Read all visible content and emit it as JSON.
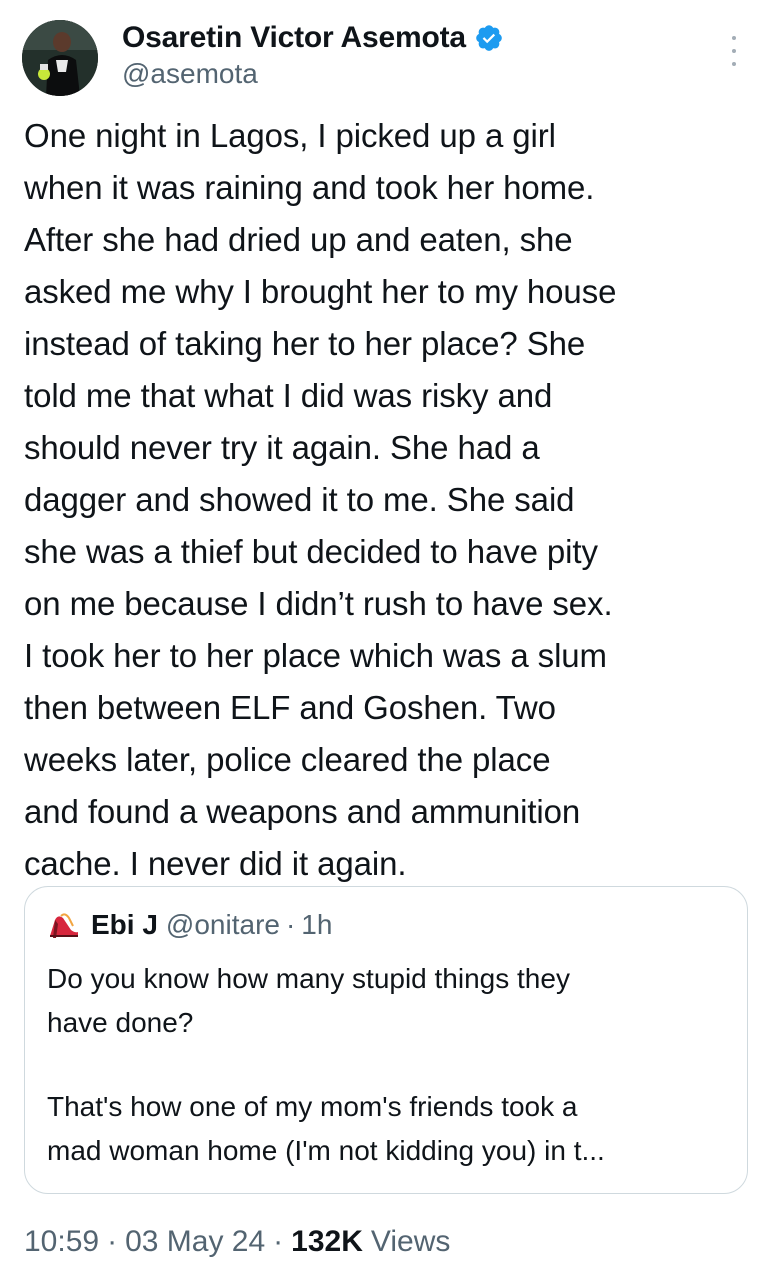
{
  "author": {
    "display_name": "Osaretin Victor Asemota",
    "handle": "@asemota",
    "verified": true,
    "verified_color": "#1d9bf0",
    "avatar_icon": "profile-photo-avatar"
  },
  "menu": {
    "icon": "more-vertical-icon"
  },
  "tweet": {
    "lines": [
      "One night in Lagos, I picked up a girl",
      "when it was raining and took her home.",
      "After she had dried up and eaten, she",
      "asked me why I brought her to my house",
      "instead of taking her to her place? She",
      "told me that what I did was risky and",
      "should never try it again. She had a",
      "dagger and showed it to me. She said",
      "she was a thief but decided to have pity",
      "on me because I didn’t rush to have sex.",
      "I took her to her place which was a slum",
      "then between ELF and Goshen. Two",
      "weeks later, police cleared the place",
      "and found a weapons and ammunition",
      "cache. I never did it again."
    ]
  },
  "quote": {
    "name": "Ebi J",
    "handle": "@onitare",
    "separator": "·",
    "time": "1h",
    "avatar_icon": "high-heel-avatar",
    "paragraph1": [
      "Do you know how many stupid things they",
      "have done?"
    ],
    "paragraph2": [
      "That's how one of my mom's friends took a",
      "mad woman home (I'm not kidding you) in t..."
    ]
  },
  "meta": {
    "time": "10:59",
    "separator": "·",
    "date": "03 May 24",
    "views_count": "132K",
    "views_label": "Views"
  },
  "colors": {
    "text_primary": "#0f1419",
    "text_secondary": "#536471",
    "border": "#cfd9de",
    "accent": "#1d9bf0"
  }
}
